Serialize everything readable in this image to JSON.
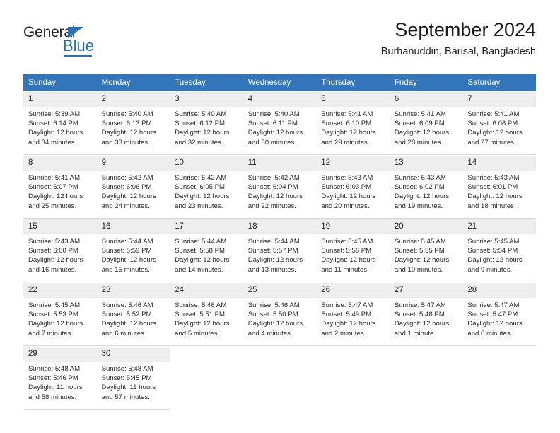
{
  "brand": {
    "name_top": "General",
    "name_bottom": "Blue",
    "accent_color": "#2b72b4"
  },
  "header": {
    "title": "September 2024",
    "subtitle": "Burhanuddin, Barisal, Bangladesh"
  },
  "colors": {
    "header_bar": "#3275bb",
    "daynum_band": "#eeeeee",
    "cell_divider": "#d9d9d9",
    "text": "#2a2a2a"
  },
  "weekday_headers": [
    "Sunday",
    "Monday",
    "Tuesday",
    "Wednesday",
    "Thursday",
    "Friday",
    "Saturday"
  ],
  "labels": {
    "sunrise_prefix": "Sunrise:",
    "sunset_prefix": "Sunset:",
    "daylight_prefix": "Daylight:"
  },
  "weeks": [
    [
      {
        "day": "1",
        "sunrise": "Sunrise: 5:39 AM",
        "sunset": "Sunset: 6:14 PM",
        "daylight_1": "Daylight: 12 hours",
        "daylight_2": "and 34 minutes."
      },
      {
        "day": "2",
        "sunrise": "Sunrise: 5:40 AM",
        "sunset": "Sunset: 6:13 PM",
        "daylight_1": "Daylight: 12 hours",
        "daylight_2": "and 33 minutes."
      },
      {
        "day": "3",
        "sunrise": "Sunrise: 5:40 AM",
        "sunset": "Sunset: 6:12 PM",
        "daylight_1": "Daylight: 12 hours",
        "daylight_2": "and 32 minutes."
      },
      {
        "day": "4",
        "sunrise": "Sunrise: 5:40 AM",
        "sunset": "Sunset: 6:11 PM",
        "daylight_1": "Daylight: 12 hours",
        "daylight_2": "and 30 minutes."
      },
      {
        "day": "5",
        "sunrise": "Sunrise: 5:41 AM",
        "sunset": "Sunset: 6:10 PM",
        "daylight_1": "Daylight: 12 hours",
        "daylight_2": "and 29 minutes."
      },
      {
        "day": "6",
        "sunrise": "Sunrise: 5:41 AM",
        "sunset": "Sunset: 6:09 PM",
        "daylight_1": "Daylight: 12 hours",
        "daylight_2": "and 28 minutes."
      },
      {
        "day": "7",
        "sunrise": "Sunrise: 5:41 AM",
        "sunset": "Sunset: 6:08 PM",
        "daylight_1": "Daylight: 12 hours",
        "daylight_2": "and 27 minutes."
      }
    ],
    [
      {
        "day": "8",
        "sunrise": "Sunrise: 5:41 AM",
        "sunset": "Sunset: 6:07 PM",
        "daylight_1": "Daylight: 12 hours",
        "daylight_2": "and 25 minutes."
      },
      {
        "day": "9",
        "sunrise": "Sunrise: 5:42 AM",
        "sunset": "Sunset: 6:06 PM",
        "daylight_1": "Daylight: 12 hours",
        "daylight_2": "and 24 minutes."
      },
      {
        "day": "10",
        "sunrise": "Sunrise: 5:42 AM",
        "sunset": "Sunset: 6:05 PM",
        "daylight_1": "Daylight: 12 hours",
        "daylight_2": "and 23 minutes."
      },
      {
        "day": "11",
        "sunrise": "Sunrise: 5:42 AM",
        "sunset": "Sunset: 6:04 PM",
        "daylight_1": "Daylight: 12 hours",
        "daylight_2": "and 22 minutes."
      },
      {
        "day": "12",
        "sunrise": "Sunrise: 5:43 AM",
        "sunset": "Sunset: 6:03 PM",
        "daylight_1": "Daylight: 12 hours",
        "daylight_2": "and 20 minutes."
      },
      {
        "day": "13",
        "sunrise": "Sunrise: 5:43 AM",
        "sunset": "Sunset: 6:02 PM",
        "daylight_1": "Daylight: 12 hours",
        "daylight_2": "and 19 minutes."
      },
      {
        "day": "14",
        "sunrise": "Sunrise: 5:43 AM",
        "sunset": "Sunset: 6:01 PM",
        "daylight_1": "Daylight: 12 hours",
        "daylight_2": "and 18 minutes."
      }
    ],
    [
      {
        "day": "15",
        "sunrise": "Sunrise: 5:43 AM",
        "sunset": "Sunset: 6:00 PM",
        "daylight_1": "Daylight: 12 hours",
        "daylight_2": "and 16 minutes."
      },
      {
        "day": "16",
        "sunrise": "Sunrise: 5:44 AM",
        "sunset": "Sunset: 5:59 PM",
        "daylight_1": "Daylight: 12 hours",
        "daylight_2": "and 15 minutes."
      },
      {
        "day": "17",
        "sunrise": "Sunrise: 5:44 AM",
        "sunset": "Sunset: 5:58 PM",
        "daylight_1": "Daylight: 12 hours",
        "daylight_2": "and 14 minutes."
      },
      {
        "day": "18",
        "sunrise": "Sunrise: 5:44 AM",
        "sunset": "Sunset: 5:57 PM",
        "daylight_1": "Daylight: 12 hours",
        "daylight_2": "and 13 minutes."
      },
      {
        "day": "19",
        "sunrise": "Sunrise: 5:45 AM",
        "sunset": "Sunset: 5:56 PM",
        "daylight_1": "Daylight: 12 hours",
        "daylight_2": "and 11 minutes."
      },
      {
        "day": "20",
        "sunrise": "Sunrise: 5:45 AM",
        "sunset": "Sunset: 5:55 PM",
        "daylight_1": "Daylight: 12 hours",
        "daylight_2": "and 10 minutes."
      },
      {
        "day": "21",
        "sunrise": "Sunrise: 5:45 AM",
        "sunset": "Sunset: 5:54 PM",
        "daylight_1": "Daylight: 12 hours",
        "daylight_2": "and 9 minutes."
      }
    ],
    [
      {
        "day": "22",
        "sunrise": "Sunrise: 5:45 AM",
        "sunset": "Sunset: 5:53 PM",
        "daylight_1": "Daylight: 12 hours",
        "daylight_2": "and 7 minutes."
      },
      {
        "day": "23",
        "sunrise": "Sunrise: 5:46 AM",
        "sunset": "Sunset: 5:52 PM",
        "daylight_1": "Daylight: 12 hours",
        "daylight_2": "and 6 minutes."
      },
      {
        "day": "24",
        "sunrise": "Sunrise: 5:46 AM",
        "sunset": "Sunset: 5:51 PM",
        "daylight_1": "Daylight: 12 hours",
        "daylight_2": "and 5 minutes."
      },
      {
        "day": "25",
        "sunrise": "Sunrise: 5:46 AM",
        "sunset": "Sunset: 5:50 PM",
        "daylight_1": "Daylight: 12 hours",
        "daylight_2": "and 4 minutes."
      },
      {
        "day": "26",
        "sunrise": "Sunrise: 5:47 AM",
        "sunset": "Sunset: 5:49 PM",
        "daylight_1": "Daylight: 12 hours",
        "daylight_2": "and 2 minutes."
      },
      {
        "day": "27",
        "sunrise": "Sunrise: 5:47 AM",
        "sunset": "Sunset: 5:48 PM",
        "daylight_1": "Daylight: 12 hours",
        "daylight_2": "and 1 minute."
      },
      {
        "day": "28",
        "sunrise": "Sunrise: 5:47 AM",
        "sunset": "Sunset: 5:47 PM",
        "daylight_1": "Daylight: 12 hours",
        "daylight_2": "and 0 minutes."
      }
    ],
    [
      {
        "day": "29",
        "sunrise": "Sunrise: 5:48 AM",
        "sunset": "Sunset: 5:46 PM",
        "daylight_1": "Daylight: 11 hours",
        "daylight_2": "and 58 minutes."
      },
      {
        "day": "30",
        "sunrise": "Sunrise: 5:48 AM",
        "sunset": "Sunset: 5:45 PM",
        "daylight_1": "Daylight: 11 hours",
        "daylight_2": "and 57 minutes."
      },
      null,
      null,
      null,
      null,
      null
    ]
  ]
}
